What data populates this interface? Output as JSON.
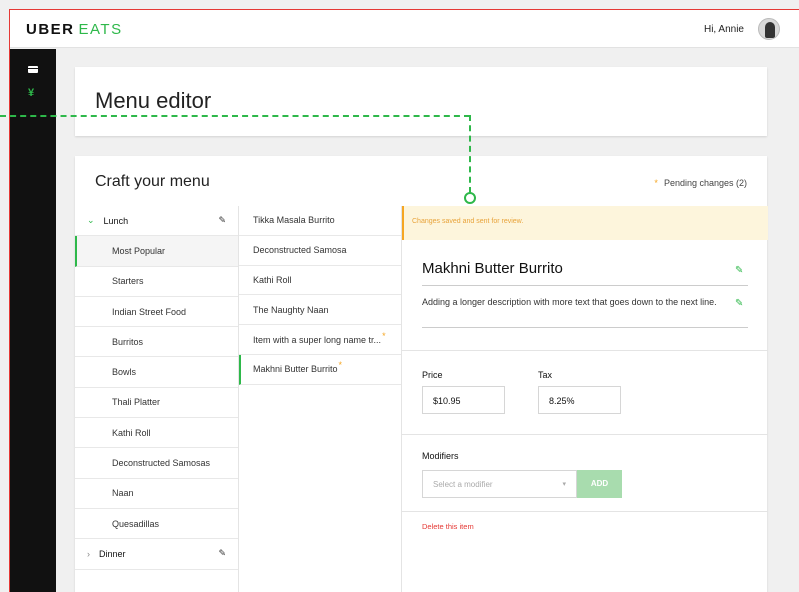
{
  "topbar": {
    "logo_part1": "UBER",
    "logo_part2": "EATS",
    "greeting": "Hi, Annie"
  },
  "sidebar": {
    "icons": [
      "card-icon",
      "fork-knife-icon"
    ]
  },
  "header": {
    "title": "Menu editor"
  },
  "craft": {
    "title": "Craft your menu",
    "pending_marker": "*",
    "pending_label": "Pending changes (2)"
  },
  "categories": {
    "lunch": {
      "label": "Lunch",
      "items": [
        "Most Popular",
        "Starters",
        "Indian Street Food",
        "Burritos",
        "Bowls",
        "Thali Platter",
        "Kathi Roll",
        "Deconstructed Samosas",
        "Naan",
        "Quesadillas"
      ]
    },
    "dinner": {
      "label": "Dinner"
    }
  },
  "items": [
    {
      "label": "Tikka Masala Burrito",
      "pending": ""
    },
    {
      "label": "Deconstructed Samosa",
      "pending": ""
    },
    {
      "label": "Kathi Roll",
      "pending": ""
    },
    {
      "label": "The Naughty Naan",
      "pending": ""
    },
    {
      "label": "Item with a super long name tr...",
      "pending": "*"
    },
    {
      "label": "Makhni Butter Burrito",
      "pending": "*"
    }
  ],
  "detail": {
    "banner": "Changes saved and sent for review.",
    "name": "Makhni Butter Burrito",
    "description": "Adding a longer description with more text that goes down to the next line.",
    "price_label": "Price",
    "price_value": "$10.95",
    "tax_label": "Tax",
    "tax_value": "8.25%",
    "modifiers_label": "Modifiers",
    "modifier_placeholder": "Select a modifier",
    "add_label": "ADD",
    "delete_label": "Delete this item"
  },
  "colors": {
    "accent": "#2eb84a",
    "warning": "#f5a623",
    "danger": "#e53935"
  }
}
